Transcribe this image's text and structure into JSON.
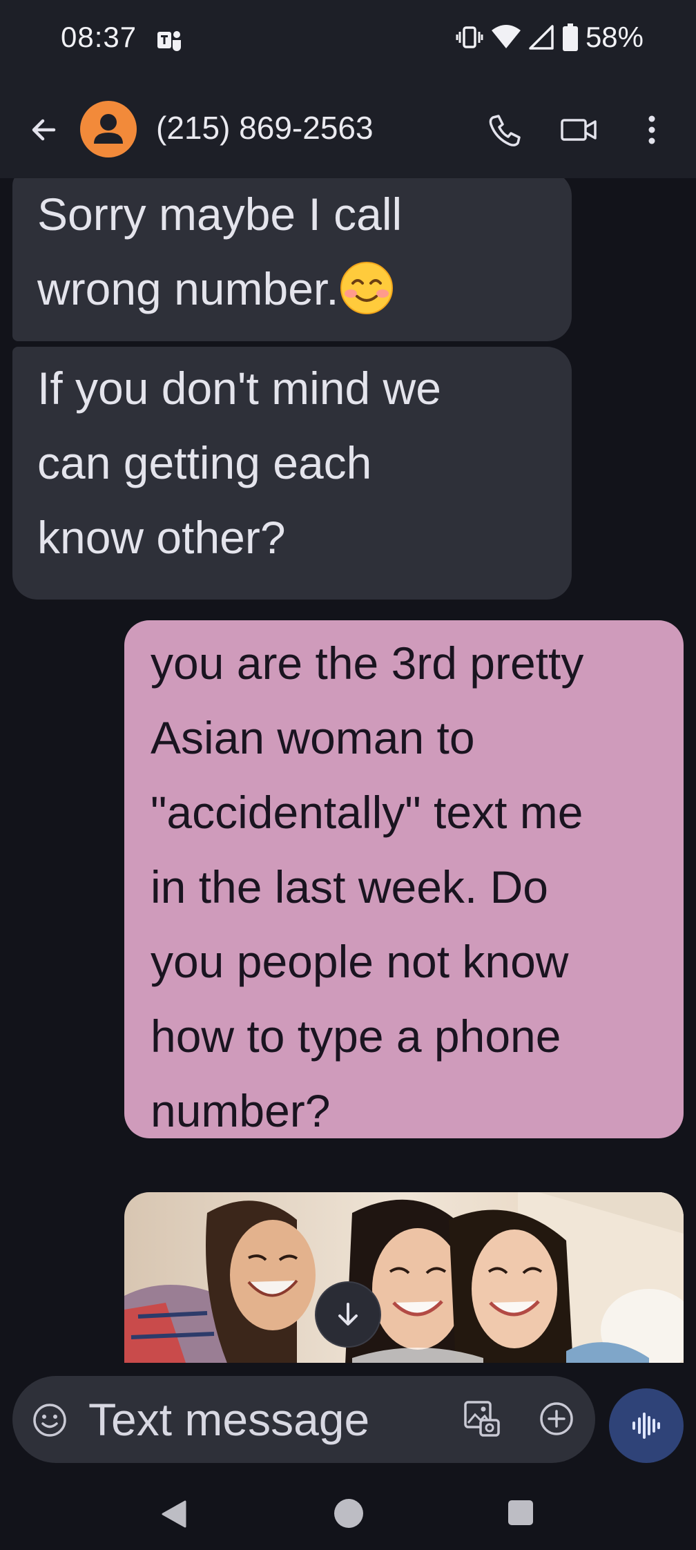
{
  "status_bar": {
    "time": "08:37",
    "battery": "58%",
    "icons": [
      "teams-icon",
      "vibrate-icon",
      "wifi-icon",
      "cell-signal-icon",
      "battery-icon"
    ]
  },
  "header": {
    "contact": "(215) 869-2563",
    "actions": [
      "back-icon",
      "phone-icon",
      "video-icon",
      "more-vert-icon"
    ],
    "avatar_color": "#f28a3a"
  },
  "messages": [
    {
      "direction": "incoming",
      "lines": [
        "Sorry maybe I call",
        "wrong number."
      ],
      "emoji": "smiling-face-emoji"
    },
    {
      "direction": "incoming",
      "lines": [
        "If you don't mind we",
        "can getting each",
        "know other?"
      ]
    },
    {
      "direction": "outgoing",
      "lines": [
        "you are the 3rd pretty",
        "Asian woman to",
        "\"accidentally\" text me",
        "in the last week.  Do",
        "you people not know",
        "how to type a phone",
        "number?"
      ]
    }
  ],
  "attachment": {
    "kind": "photo",
    "description_icon": "image"
  },
  "composer": {
    "placeholder": "Text message",
    "value": ""
  },
  "colors": {
    "incoming_bubble": "#2e3039",
    "outgoing_bubble": "#cf9bbb",
    "background": "#12131a",
    "bar": "#1d1f27",
    "voice_button": "#2f4378"
  }
}
